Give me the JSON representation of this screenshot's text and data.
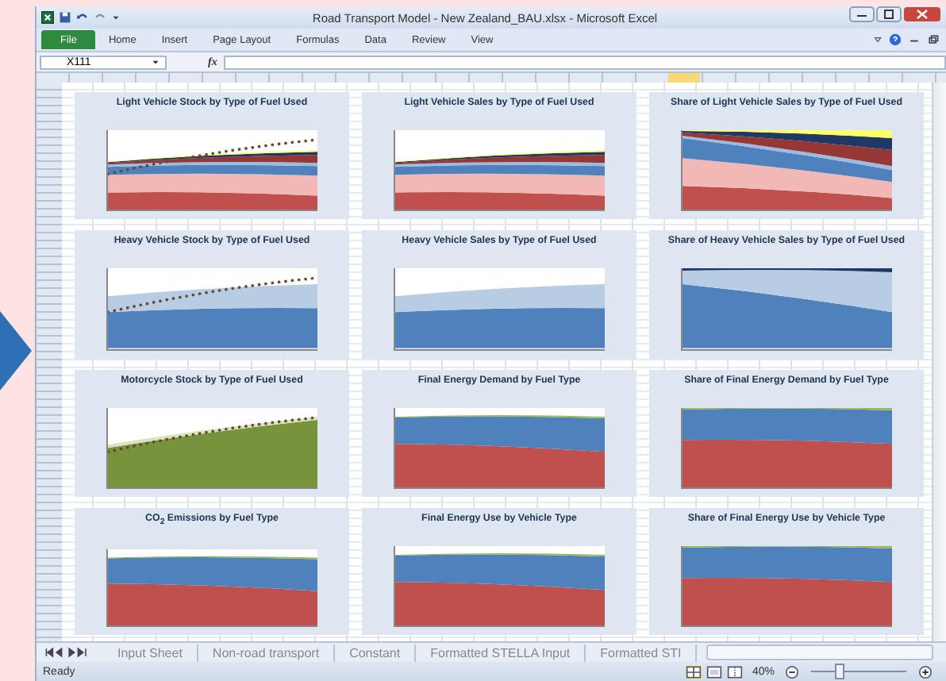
{
  "window": {
    "title": "Road Transport Model - New Zealand_BAU.xlsx - Microsoft Excel"
  },
  "ribbon_tabs": [
    {
      "label": "File",
      "selected": true
    },
    {
      "label": "Home",
      "selected": false
    },
    {
      "label": "Insert",
      "selected": false
    },
    {
      "label": "Page Layout",
      "selected": false
    },
    {
      "label": "Formulas",
      "selected": false
    },
    {
      "label": "Data",
      "selected": false
    },
    {
      "label": "Review",
      "selected": false
    },
    {
      "label": "View",
      "selected": false
    }
  ],
  "formula_bar": {
    "name_box": "X111",
    "function_label": "fx"
  },
  "charts": [
    {
      "title": "Light Vehicle Stock by Type of Fuel Used",
      "kind": "multi-fuel",
      "trend_line": true
    },
    {
      "title": "Light Vehicle Sales by Type of Fuel Used",
      "kind": "multi-fuel",
      "trend_line": false
    },
    {
      "title": "Share of Light Vehicle Sales by Type of Fuel Used",
      "kind": "multi-fuel-share",
      "trend_line": false
    },
    {
      "title": "Heavy Vehicle Stock by Type of Fuel Used",
      "kind": "heavy",
      "trend_line": true
    },
    {
      "title": "Heavy Vehicle Sales by Type of Fuel Used",
      "kind": "heavy",
      "trend_line": false
    },
    {
      "title": "Share of Heavy Vehicle Sales by Type of Fuel Used",
      "kind": "heavy-share",
      "trend_line": false
    },
    {
      "title": "Motorcycle Stock by Type of Fuel Used",
      "kind": "motorcycle",
      "trend_line": true
    },
    {
      "title": "Final Energy Demand by Fuel Type",
      "kind": "two-fuel",
      "trend_line": false
    },
    {
      "title": "Share of Final Energy Demand by Fuel Type",
      "kind": "two-fuel-share",
      "trend_line": false
    },
    {
      "title": "CO$_{2}$ Emissions by Fuel Type",
      "kind": "two-fuel",
      "trend_line": false
    },
    {
      "title": "Final Energy Use by Vehicle Type",
      "kind": "two-fuel",
      "trend_line": false
    },
    {
      "title": "Share of Final Energy Use by Vehicle Type",
      "kind": "two-fuel-share",
      "trend_line": false
    }
  ],
  "sheet_tabs": [
    {
      "label": "Input Sheet",
      "selected": false
    },
    {
      "label": "Non-road transport",
      "selected": false
    },
    {
      "label": "Constant",
      "selected": false
    },
    {
      "label": "Formatted STELLA Input",
      "selected": false
    },
    {
      "label": "Formatted STI",
      "selected": false
    }
  ],
  "status_bar": {
    "status": "Ready",
    "zoom": "40%",
    "level": 0.3
  }
}
